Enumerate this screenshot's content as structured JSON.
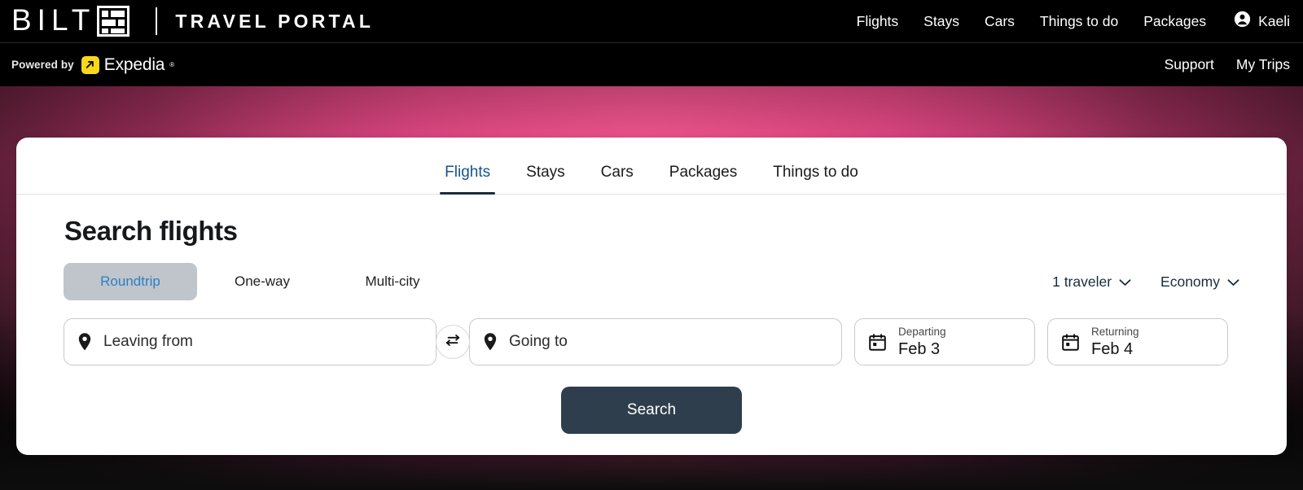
{
  "brand": {
    "name": "BILT",
    "sub": "TRAVEL PORTAL",
    "mark_icon": "brick-grid-icon"
  },
  "topnav": {
    "items": [
      {
        "label": "Flights"
      },
      {
        "label": "Stays"
      },
      {
        "label": "Cars"
      },
      {
        "label": "Things to do"
      },
      {
        "label": "Packages"
      }
    ],
    "account": {
      "label": "Kaeli",
      "icon": "account-circle-icon"
    }
  },
  "subbar": {
    "powered_by": "Powered by",
    "partner": "Expedia",
    "partner_tm": "®",
    "partner_icon": "expedia-arrow-icon",
    "partner_badge_color": "#F7D917",
    "links": [
      {
        "label": "Support"
      },
      {
        "label": "My Trips"
      }
    ]
  },
  "hero": {
    "gradient_center": "#F0548C",
    "gradient_mid": "#C43878",
    "gradient_edge": "#0D0D0D"
  },
  "card": {
    "tabs": [
      {
        "label": "Flights",
        "active": true
      },
      {
        "label": "Stays",
        "active": false
      },
      {
        "label": "Cars",
        "active": false
      },
      {
        "label": "Packages",
        "active": false
      },
      {
        "label": "Things to do",
        "active": false
      }
    ],
    "title": "Search flights",
    "trip_types": [
      {
        "label": "Roundtrip",
        "active": true
      },
      {
        "label": "One-way",
        "active": false
      },
      {
        "label": "Multi-city",
        "active": false
      }
    ],
    "travelers": {
      "value": "1 traveler",
      "icon": "chevron-down-icon"
    },
    "cabin": {
      "value": "Economy",
      "icon": "chevron-down-icon"
    },
    "origin": {
      "placeholder": "Leaving from",
      "value": "",
      "icon": "location-pin-icon"
    },
    "destination": {
      "placeholder": "Going to",
      "value": "",
      "icon": "location-pin-icon"
    },
    "swap": {
      "icon": "swap-horizontal-icon"
    },
    "departing": {
      "label": "Departing",
      "value": "Feb 3",
      "icon": "calendar-icon"
    },
    "returning": {
      "label": "Returning",
      "value": "Feb 4",
      "icon": "calendar-icon"
    },
    "search_button": {
      "label": "Search",
      "color": "#2F3E4D"
    }
  }
}
